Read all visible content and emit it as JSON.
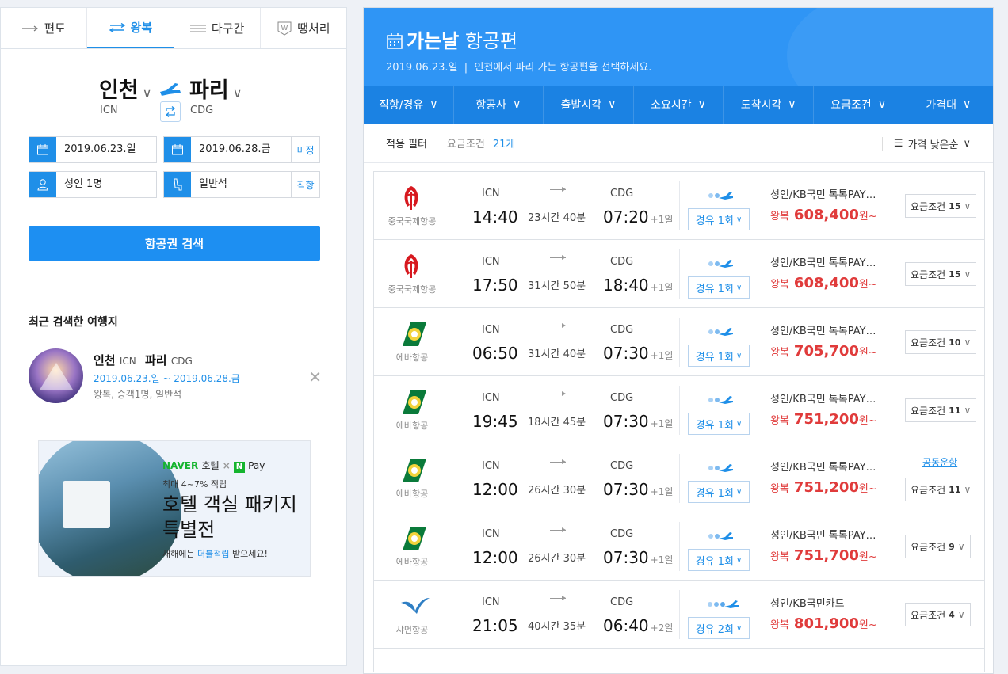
{
  "tabs": [
    {
      "label": "편도",
      "icon": "one-way-arrow-icon"
    },
    {
      "label": "왕복",
      "icon": "round-trip-arrows-icon"
    },
    {
      "label": "다구간",
      "icon": "multi-city-lines-icon"
    },
    {
      "label": "땡처리",
      "icon": "last-minute-badge-icon"
    }
  ],
  "search": {
    "origin_city": "인천",
    "origin_code": "ICN",
    "dest_city": "파리",
    "dest_code": "CDG",
    "depart_date": "2019.06.23.일",
    "return_date": "2019.06.28.금",
    "return_side": "미정",
    "passengers": "성인 1명",
    "seat_class": "일반석",
    "seat_side": "직항",
    "button": "항공권 검색"
  },
  "recent": {
    "title": "최근 검색한 여행지",
    "origin": "인천",
    "origin_code": "ICN",
    "dest": "파리",
    "dest_code": "CDG",
    "dates": "2019.06.23.일 ~ 2019.06.28.금",
    "details": "왕복, 승객1명, 일반석"
  },
  "banner": {
    "naver": "NAVER",
    "hotel": "호텔",
    "times": "×",
    "n": "N",
    "pay": "Pay",
    "sub": "최대 4~7% 적립",
    "headline": "호텔 객실 패키지 특별전",
    "foot_pre": "새해에는 ",
    "foot_hl": "더블적립",
    "foot_post": " 받으세요!"
  },
  "header": {
    "title_bold": "가는날",
    "title_rest": " 항공편",
    "date": "2019.06.23.일",
    "desc": "인천에서 파리 가는 항공편을 선택하세요."
  },
  "filters": [
    "직항/경유",
    "항공사",
    "출발시각",
    "소요시간",
    "도착시각",
    "요금조건",
    "가격대"
  ],
  "applied": {
    "label": "적용 필터",
    "filter": "요금조건",
    "count": "21개",
    "sort": "가격 낮은순"
  },
  "colors": {
    "accent": "#1f8fe8",
    "header": "#2f95f5",
    "filterbar": "#1b82e3",
    "price": "#e03b3b"
  },
  "flights": [
    {
      "airline": "중국국제항공",
      "logo": "air-china-logo",
      "dep_code": "ICN",
      "dep_time": "14:40",
      "duration": "23시간 40분",
      "arr_code": "CDG",
      "arr_time": "07:20",
      "day": "+1일",
      "stops": "경유 1회",
      "fare": "성인/KB국민 톡톡PAY…",
      "trip": "왕복",
      "price": "608,400",
      "unit": "원~",
      "cond": "요금조건",
      "cond_n": "15",
      "joint": ""
    },
    {
      "airline": "중국국제항공",
      "logo": "air-china-logo",
      "dep_code": "ICN",
      "dep_time": "17:50",
      "duration": "31시간 50분",
      "arr_code": "CDG",
      "arr_time": "18:40",
      "day": "+1일",
      "stops": "경유 1회",
      "fare": "성인/KB국민 톡톡PAY…",
      "trip": "왕복",
      "price": "608,400",
      "unit": "원~",
      "cond": "요금조건",
      "cond_n": "15",
      "joint": ""
    },
    {
      "airline": "에바항공",
      "logo": "eva-air-logo",
      "dep_code": "ICN",
      "dep_time": "06:50",
      "duration": "31시간 40분",
      "arr_code": "CDG",
      "arr_time": "07:30",
      "day": "+1일",
      "stops": "경유 1회",
      "fare": "성인/KB국민 톡톡PAY…",
      "trip": "왕복",
      "price": "705,700",
      "unit": "원~",
      "cond": "요금조건",
      "cond_n": "10",
      "joint": ""
    },
    {
      "airline": "에바항공",
      "logo": "eva-air-logo",
      "dep_code": "ICN",
      "dep_time": "19:45",
      "duration": "18시간 45분",
      "arr_code": "CDG",
      "arr_time": "07:30",
      "day": "+1일",
      "stops": "경유 1회",
      "fare": "성인/KB국민 톡톡PAY…",
      "trip": "왕복",
      "price": "751,200",
      "unit": "원~",
      "cond": "요금조건",
      "cond_n": "11",
      "joint": ""
    },
    {
      "airline": "에바항공",
      "logo": "eva-air-logo",
      "dep_code": "ICN",
      "dep_time": "12:00",
      "duration": "26시간 30분",
      "arr_code": "CDG",
      "arr_time": "07:30",
      "day": "+1일",
      "stops": "경유 1회",
      "fare": "성인/KB국민 톡톡PAY…",
      "trip": "왕복",
      "price": "751,200",
      "unit": "원~",
      "cond": "요금조건",
      "cond_n": "11",
      "joint": "공동운항"
    },
    {
      "airline": "에바항공",
      "logo": "eva-air-logo",
      "dep_code": "ICN",
      "dep_time": "12:00",
      "duration": "26시간 30분",
      "arr_code": "CDG",
      "arr_time": "07:30",
      "day": "+1일",
      "stops": "경유 1회",
      "fare": "성인/KB국민 톡톡PAY…",
      "trip": "왕복",
      "price": "751,700",
      "unit": "원~",
      "cond": "요금조건",
      "cond_n": "9",
      "joint": ""
    },
    {
      "airline": "샤먼항공",
      "logo": "xiamen-air-logo",
      "dep_code": "ICN",
      "dep_time": "21:05",
      "duration": "40시간 35분",
      "arr_code": "CDG",
      "arr_time": "06:40",
      "day": "+2일",
      "stops": "경유 2회",
      "fare": "성인/KB국민카드",
      "trip": "왕복",
      "price": "801,900",
      "unit": "원~",
      "cond": "요금조건",
      "cond_n": "4",
      "joint": ""
    }
  ]
}
